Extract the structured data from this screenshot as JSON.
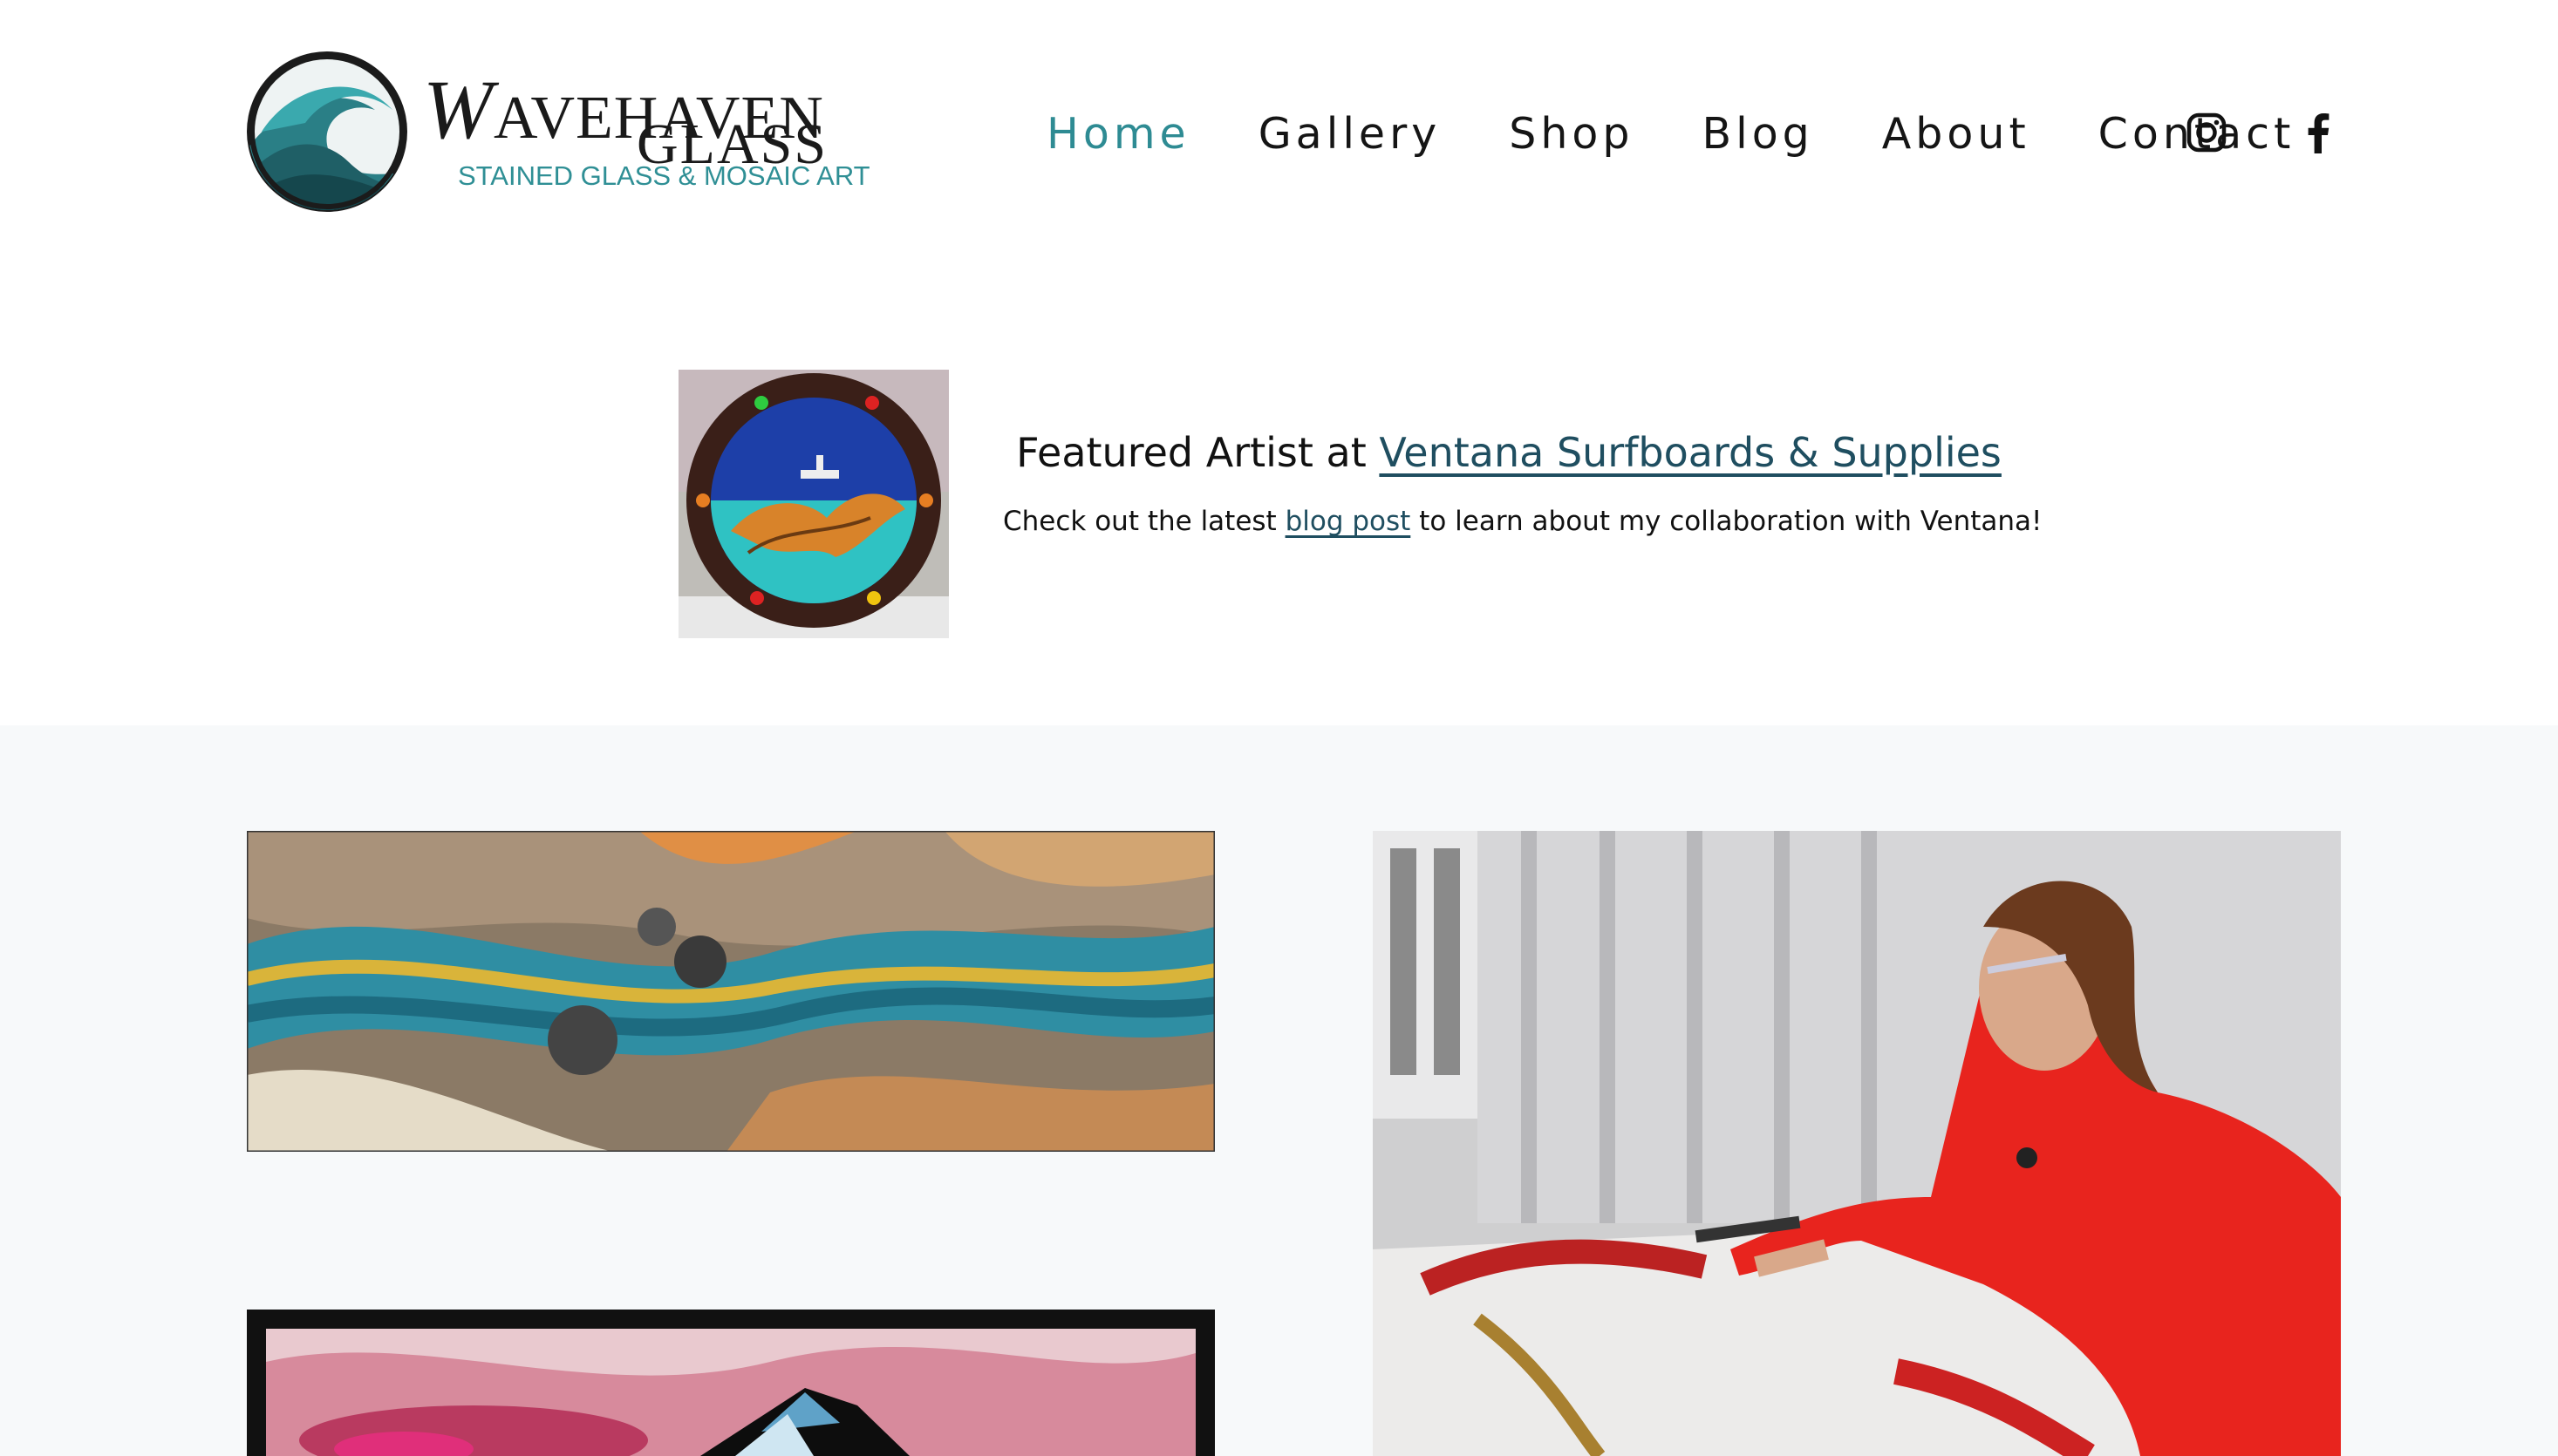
{
  "brand": {
    "name_line1_cap": "W",
    "name_line1_rest": "AVEHAVEN",
    "name_line2": "GLASS",
    "tagline": "STAINED GLASS & MOSAIC ART"
  },
  "nav": {
    "items": [
      {
        "label": "Home",
        "active": true
      },
      {
        "label": "Gallery",
        "active": false
      },
      {
        "label": "Shop",
        "active": false
      },
      {
        "label": "Blog",
        "active": false
      },
      {
        "label": "About",
        "active": false
      },
      {
        "label": "Contact",
        "active": false
      }
    ],
    "social": [
      "instagram-icon",
      "facebook-icon"
    ]
  },
  "featured": {
    "title_prefix": "Featured Artist at ",
    "title_link": "Ventana Surfboards & Supplies",
    "subtitle_prefix": "Check out the latest ",
    "subtitle_link": "blog post",
    "subtitle_suffix": " to learn about my collaboration with Ventana!"
  },
  "colors": {
    "accent": "#2e8b93",
    "link": "#1f4e60",
    "text": "#111111",
    "gallery_bg": "#f7f9fa"
  },
  "images": [
    "porthole-stained-glass-thumbnail",
    "wave-mosaic-artwork",
    "artist-working-photo",
    "mountain-stained-glass-artwork"
  ]
}
